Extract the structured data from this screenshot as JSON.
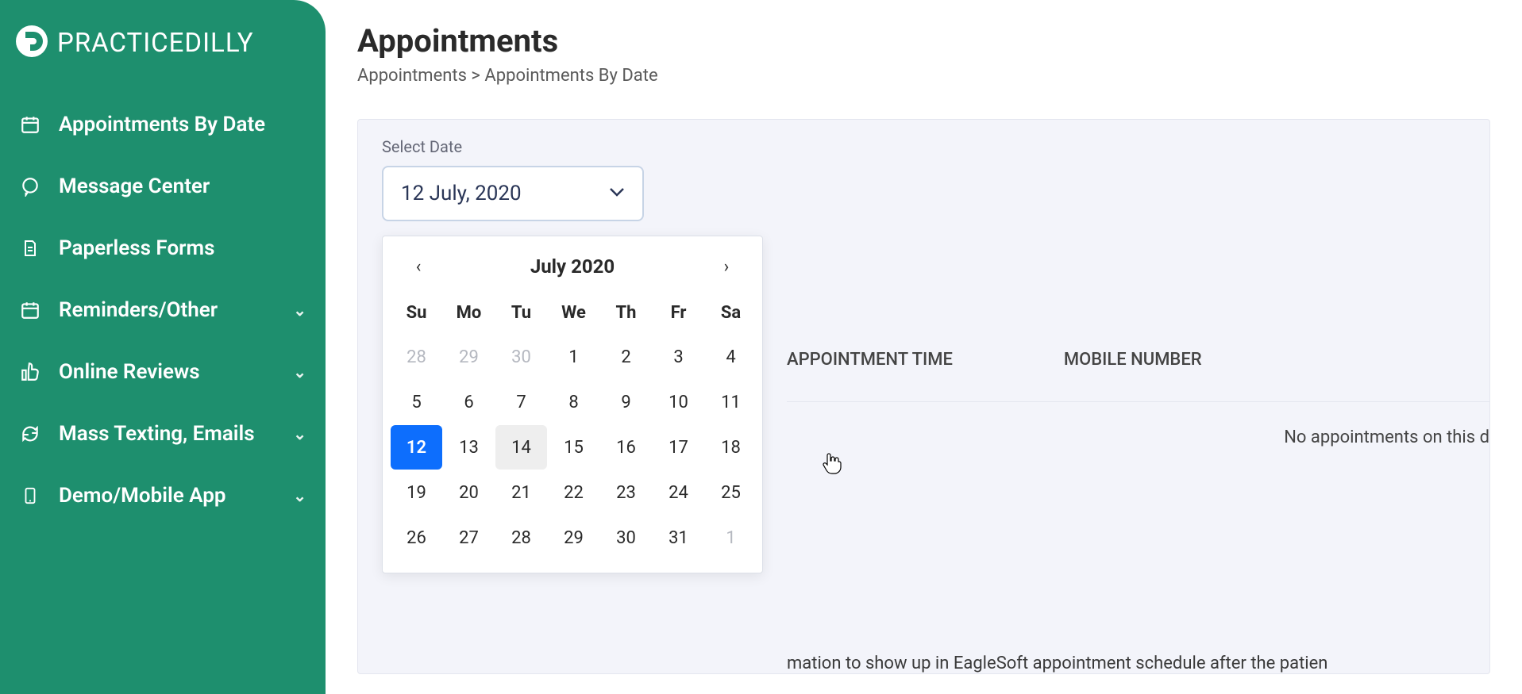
{
  "brand": {
    "name": "PRACTICEDILLY"
  },
  "sidebar": {
    "items": [
      {
        "label": "Appointments By Date",
        "icon": "calendar-icon",
        "expandable": false
      },
      {
        "label": "Message Center",
        "icon": "chat-icon",
        "expandable": false
      },
      {
        "label": "Paperless Forms",
        "icon": "document-icon",
        "expandable": false
      },
      {
        "label": "Reminders/Other",
        "icon": "bell-icon",
        "expandable": true
      },
      {
        "label": "Online Reviews",
        "icon": "thumbs-up-icon",
        "expandable": true
      },
      {
        "label": "Mass Texting, Emails",
        "icon": "refresh-icon",
        "expandable": true
      },
      {
        "label": "Demo/Mobile App",
        "icon": "phone-icon",
        "expandable": true
      }
    ]
  },
  "page": {
    "title": "Appointments",
    "breadcrumb": "Appointments > Appointments By Date"
  },
  "select_date": {
    "label": "Select Date",
    "value": "12 July, 2020"
  },
  "calendar": {
    "title": "July 2020",
    "dow": [
      "Su",
      "Mo",
      "Tu",
      "We",
      "Th",
      "Fr",
      "Sa"
    ],
    "days": [
      {
        "n": 28,
        "other": true
      },
      {
        "n": 29,
        "other": true
      },
      {
        "n": 30,
        "other": true
      },
      {
        "n": 1
      },
      {
        "n": 2
      },
      {
        "n": 3
      },
      {
        "n": 4
      },
      {
        "n": 5
      },
      {
        "n": 6
      },
      {
        "n": 7
      },
      {
        "n": 8
      },
      {
        "n": 9
      },
      {
        "n": 10
      },
      {
        "n": 11
      },
      {
        "n": 12,
        "selected": true
      },
      {
        "n": 13
      },
      {
        "n": 14,
        "hovered": true
      },
      {
        "n": 15
      },
      {
        "n": 16
      },
      {
        "n": 17
      },
      {
        "n": 18
      },
      {
        "n": 19
      },
      {
        "n": 20
      },
      {
        "n": 21
      },
      {
        "n": 22
      },
      {
        "n": 23
      },
      {
        "n": 24
      },
      {
        "n": 25
      },
      {
        "n": 26
      },
      {
        "n": 27
      },
      {
        "n": 28
      },
      {
        "n": 29
      },
      {
        "n": 30
      },
      {
        "n": 31
      },
      {
        "n": 1,
        "other": true
      }
    ]
  },
  "table": {
    "headers": [
      "APPOINTMENT TIME",
      "MOBILE NUMBER"
    ],
    "empty_message": "No appointments on this d"
  },
  "hint": "mation to show up in EagleSoft appointment schedule after the patien",
  "colors": {
    "sidebar_bg": "#1e8f6e",
    "primary_blue": "#0d6efd"
  }
}
